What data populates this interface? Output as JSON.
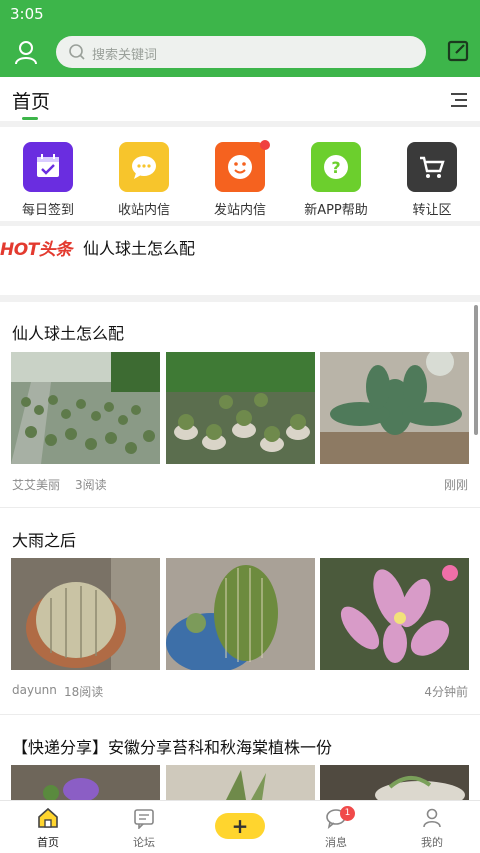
{
  "statusbar": {
    "time": "3:05"
  },
  "topbar": {
    "search_placeholder": "搜索关键词"
  },
  "tabs": {
    "home": "首页"
  },
  "quick_links": [
    {
      "label": "每日签到",
      "icon": "calendar-check-icon",
      "color": "#6a2de0"
    },
    {
      "label": "收站内信",
      "icon": "chat-bubble-icon",
      "color": "#f7c52c"
    },
    {
      "label": "发站内信",
      "icon": "smile-icon",
      "color": "#f5621f"
    },
    {
      "label": "新APP帮助",
      "icon": "question-icon",
      "color": "#6ccf2d"
    },
    {
      "label": "转让区",
      "icon": "cart-icon",
      "color": "#3a3a3a"
    }
  ],
  "hot": {
    "logo": "HOT头条",
    "headline": "仙人球土怎么配"
  },
  "posts": [
    {
      "title": "仙人球土怎么配",
      "author": "艾艾美丽",
      "reads": "3阅读",
      "time": "刚刚"
    },
    {
      "title": "大雨之后",
      "author": "dayunn",
      "reads": "18阅读",
      "time": "4分钟前"
    },
    {
      "title": "【快递分享】安徽分享苔科和秋海棠植株一份"
    }
  ],
  "bottom_nav": [
    {
      "label": "首页",
      "icon": "home-icon"
    },
    {
      "label": "论坛",
      "icon": "forum-icon"
    },
    {
      "label": "+",
      "icon": "plus-icon"
    },
    {
      "label": "消息",
      "icon": "message-icon",
      "badge": "1"
    },
    {
      "label": "我的",
      "icon": "profile-icon"
    }
  ],
  "colors": {
    "brand": "#3db54a",
    "hot": "#e33a2f",
    "accent": "#ffd52e"
  }
}
